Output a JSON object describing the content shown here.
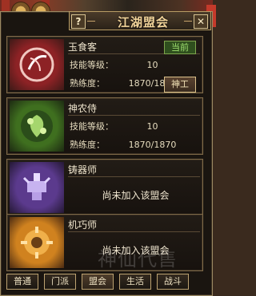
{
  "window": {
    "title": "江湖盟会",
    "help_label": "?",
    "close_label": "✕"
  },
  "cards": [
    {
      "name": "玉食客",
      "status_badge": "当前",
      "skill_level_label": "技能等级：",
      "skill_level_value": "10",
      "proficiency_label": "熟练度：",
      "proficiency_value": "1870/1870",
      "action_label": "神工",
      "emblem": "red-cooking-emblem-icon"
    },
    {
      "name": "神农侍",
      "skill_level_label": "技能等级：",
      "skill_level_value": "10",
      "proficiency_label": "熟练度：",
      "proficiency_value": "1870/1870",
      "emblem": "green-herb-emblem-icon"
    },
    {
      "name": "铸器师",
      "not_joined_text": "尚未加入该盟会",
      "emblem": "purple-forge-emblem-icon"
    },
    {
      "name": "机巧师",
      "not_joined_text": "尚未加入该盟会",
      "emblem": "orange-gear-emblem-icon"
    }
  ],
  "tabs": [
    {
      "label": "普通",
      "active": false
    },
    {
      "label": "门派",
      "active": false
    },
    {
      "label": "盟会",
      "active": true
    },
    {
      "label": "生活",
      "active": false
    },
    {
      "label": "战斗",
      "active": false
    }
  ],
  "watermark": "神仙代售"
}
